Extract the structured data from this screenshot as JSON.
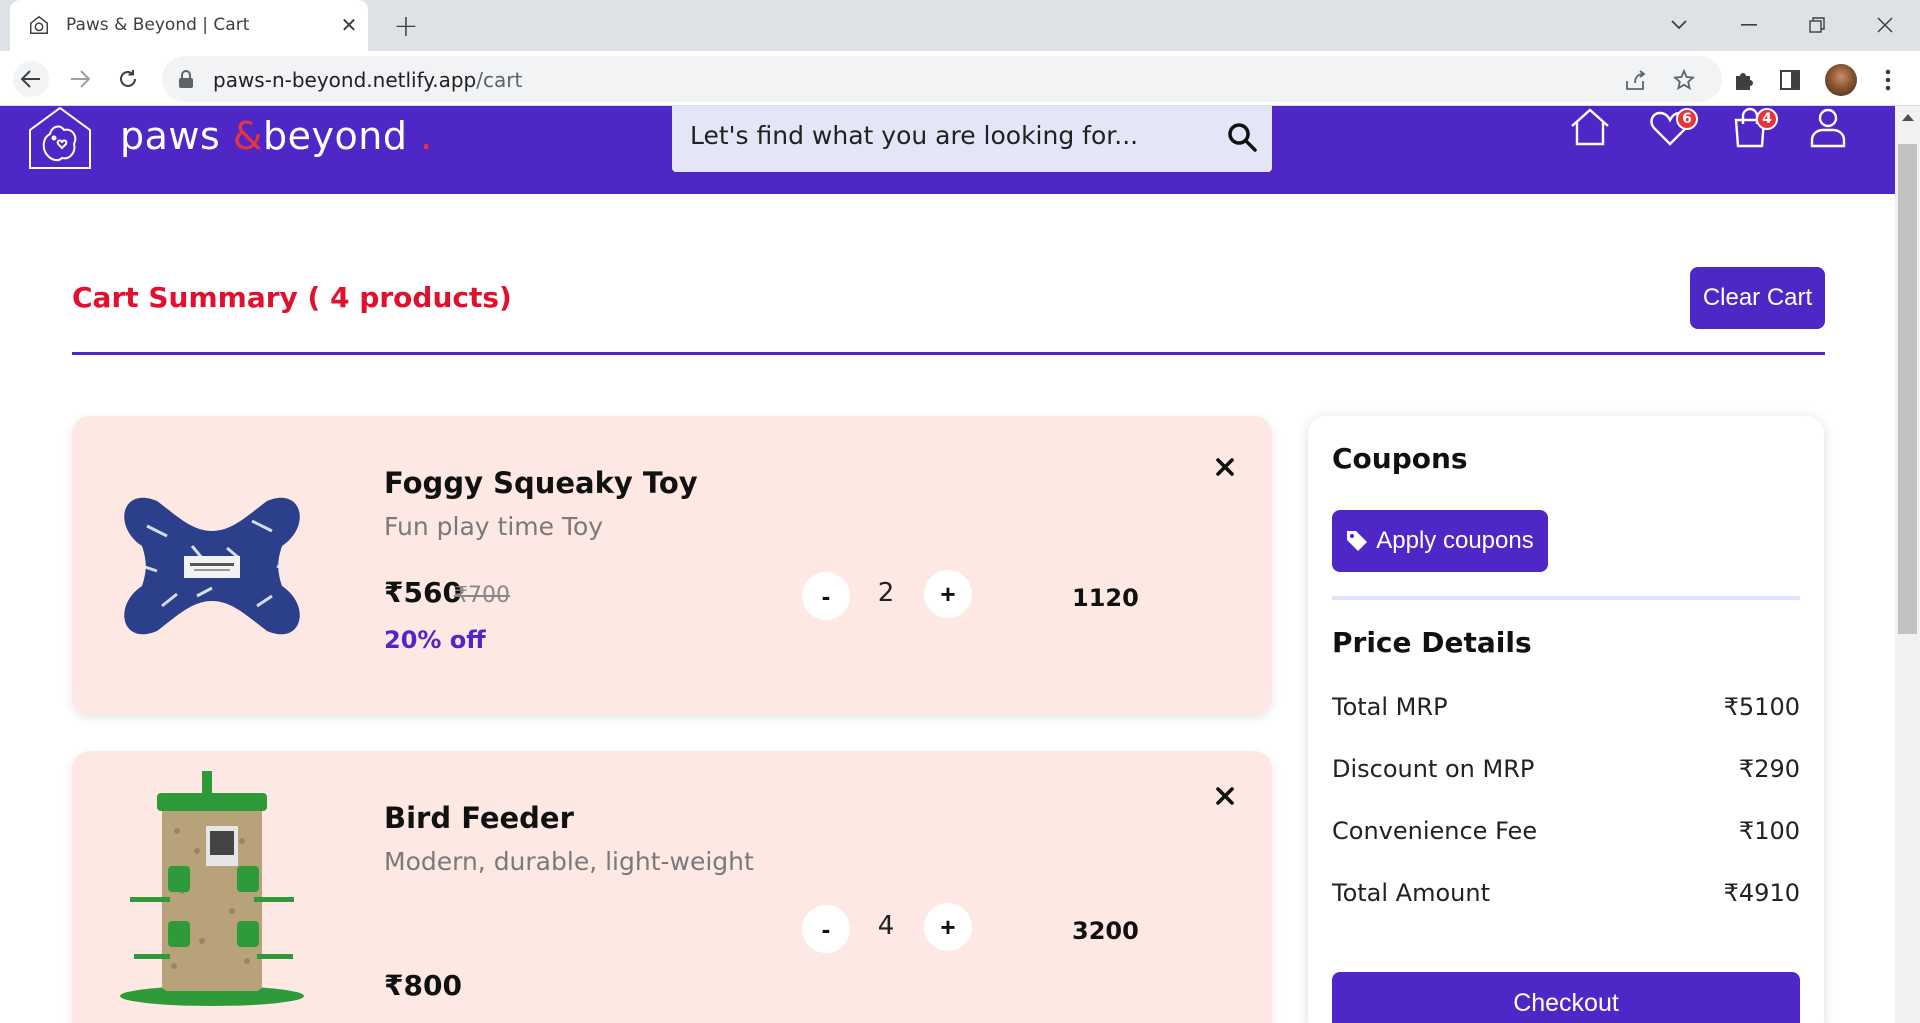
{
  "browser": {
    "tab_title": "Paws & Beyond | Cart",
    "url_host": "paws-n-beyond.netlify.app",
    "url_path": "/cart"
  },
  "header": {
    "brand_part1": "paws",
    "brand_amp": "&",
    "brand_part2": "beyond",
    "brand_dot": ".",
    "search_placeholder": "Let's find what you are looking for...",
    "wishlist_count": "6",
    "cart_count": "4"
  },
  "cart": {
    "title": "Cart Summary ( 4 products)",
    "clear_label": "Clear Cart",
    "items": [
      {
        "name": "Foggy Squeaky Toy",
        "desc": "Fun play time Toy",
        "price": "₹560",
        "mrp": "₹700",
        "discount": "20% off",
        "minus": "-",
        "qty": "2",
        "plus": "+",
        "total": "1120"
      },
      {
        "name": "Bird Feeder",
        "desc": "Modern, durable, light-weight",
        "price": "₹800",
        "minus": "-",
        "qty": "4",
        "plus": "+",
        "total": "3200"
      }
    ]
  },
  "summary": {
    "coupons_heading": "Coupons",
    "apply_label": "Apply coupons",
    "price_heading": "Price Details",
    "rows": [
      {
        "label": "Total MRP",
        "value": "₹5100"
      },
      {
        "label": "Discount on MRP",
        "value": "₹290"
      },
      {
        "label": "Convenience Fee",
        "value": "₹100"
      },
      {
        "label": "Total Amount",
        "value": "₹4910"
      }
    ],
    "checkout_label": "Checkout"
  },
  "colors": {
    "brand_purple": "#4f27c7",
    "accent_red": "#e0102e",
    "card_pink": "#fde8e4"
  },
  "icons": [
    "house-icon",
    "heart-icon",
    "shopping-bag-icon",
    "user-icon",
    "search-icon",
    "tag-icon",
    "close-icon"
  ]
}
